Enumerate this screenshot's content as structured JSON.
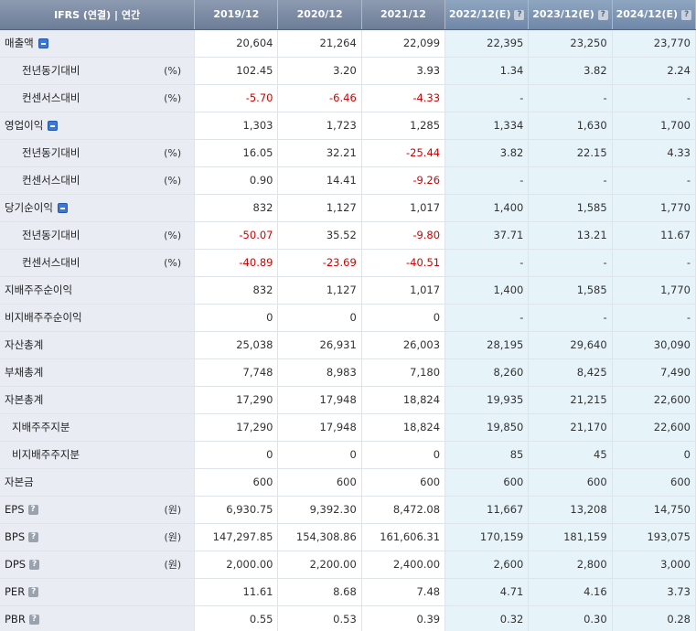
{
  "header": {
    "label": "IFRS (연결) | 연간",
    "periods": [
      "2019/12",
      "2020/12",
      "2021/12",
      "2022/12(E)",
      "2023/12(E)",
      "2024/12(E)"
    ],
    "help_glyph": "?"
  },
  "rows": [
    {
      "label": "매출액",
      "level": 0,
      "toggle": true,
      "unit": "",
      "values": [
        "20,604",
        "21,264",
        "22,099",
        "22,395",
        "23,250",
        "23,770"
      ]
    },
    {
      "label": "전년동기대비",
      "level": 1,
      "unit": "(%)",
      "values": [
        "102.45",
        "3.20",
        "3.93",
        "1.34",
        "3.82",
        "2.24"
      ]
    },
    {
      "label": "컨센서스대비",
      "level": 1,
      "unit": "(%)",
      "values": [
        "-5.70",
        "-6.46",
        "-4.33",
        "-",
        "-",
        "-"
      ]
    },
    {
      "label": "영업이익",
      "level": 0,
      "toggle": true,
      "unit": "",
      "values": [
        "1,303",
        "1,723",
        "1,285",
        "1,334",
        "1,630",
        "1,700"
      ]
    },
    {
      "label": "전년동기대비",
      "level": 1,
      "unit": "(%)",
      "values": [
        "16.05",
        "32.21",
        "-25.44",
        "3.82",
        "22.15",
        "4.33"
      ]
    },
    {
      "label": "컨센서스대비",
      "level": 1,
      "unit": "(%)",
      "values": [
        "0.90",
        "14.41",
        "-9.26",
        "-",
        "-",
        "-"
      ]
    },
    {
      "label": "당기순이익",
      "level": 0,
      "toggle": true,
      "unit": "",
      "values": [
        "832",
        "1,127",
        "1,017",
        "1,400",
        "1,585",
        "1,770"
      ]
    },
    {
      "label": "전년동기대비",
      "level": 1,
      "unit": "(%)",
      "values": [
        "-50.07",
        "35.52",
        "-9.80",
        "37.71",
        "13.21",
        "11.67"
      ]
    },
    {
      "label": "컨센서스대비",
      "level": 1,
      "unit": "(%)",
      "values": [
        "-40.89",
        "-23.69",
        "-40.51",
        "-",
        "-",
        "-"
      ]
    },
    {
      "label": "지배주주순이익",
      "level": 0,
      "unit": "",
      "values": [
        "832",
        "1,127",
        "1,017",
        "1,400",
        "1,585",
        "1,770"
      ]
    },
    {
      "label": "비지배주주순이익",
      "level": 0,
      "unit": "",
      "values": [
        "0",
        "0",
        "0",
        "-",
        "-",
        "-"
      ]
    },
    {
      "label": "자산총계",
      "level": 0,
      "unit": "",
      "values": [
        "25,038",
        "26,931",
        "26,003",
        "28,195",
        "29,640",
        "30,090"
      ]
    },
    {
      "label": "부채총계",
      "level": 0,
      "unit": "",
      "values": [
        "7,748",
        "8,983",
        "7,180",
        "8,260",
        "8,425",
        "7,490"
      ]
    },
    {
      "label": "자본총계",
      "level": 0,
      "unit": "",
      "values": [
        "17,290",
        "17,948",
        "18,824",
        "19,935",
        "21,215",
        "22,600"
      ]
    },
    {
      "label": "지배주주지분",
      "level": 2,
      "unit": "",
      "values": [
        "17,290",
        "17,948",
        "18,824",
        "19,850",
        "21,170",
        "22,600"
      ]
    },
    {
      "label": "비지배주주지분",
      "level": 2,
      "unit": "",
      "values": [
        "0",
        "0",
        "0",
        "85",
        "45",
        "0"
      ]
    },
    {
      "label": "자본금",
      "level": 0,
      "unit": "",
      "values": [
        "600",
        "600",
        "600",
        "600",
        "600",
        "600"
      ]
    },
    {
      "label": "EPS",
      "level": 0,
      "help": true,
      "unit": "(원)",
      "values": [
        "6,930.75",
        "9,392.30",
        "8,472.08",
        "11,667",
        "13,208",
        "14,750"
      ]
    },
    {
      "label": "BPS",
      "level": 0,
      "help": true,
      "unit": "(원)",
      "values": [
        "147,297.85",
        "154,308.86",
        "161,606.31",
        "170,159",
        "181,159",
        "193,075"
      ]
    },
    {
      "label": "DPS",
      "level": 0,
      "help": true,
      "unit": "(원)",
      "values": [
        "2,000.00",
        "2,200.00",
        "2,400.00",
        "2,600",
        "2,800",
        "3,000"
      ]
    },
    {
      "label": "PER",
      "level": 0,
      "help": true,
      "unit": "",
      "values": [
        "11.61",
        "8.68",
        "7.48",
        "4.71",
        "4.16",
        "3.73"
      ]
    },
    {
      "label": "PBR",
      "level": 0,
      "help": true,
      "unit": "",
      "values": [
        "0.55",
        "0.53",
        "0.39",
        "0.32",
        "0.30",
        "0.28"
      ]
    }
  ],
  "colors": {
    "header_bg": "#7a8aa3",
    "label_bg": "#e9edf3",
    "estimate_bg": "#e6f4fa",
    "negative": "#d40000",
    "toggle": "#3b78d8"
  }
}
